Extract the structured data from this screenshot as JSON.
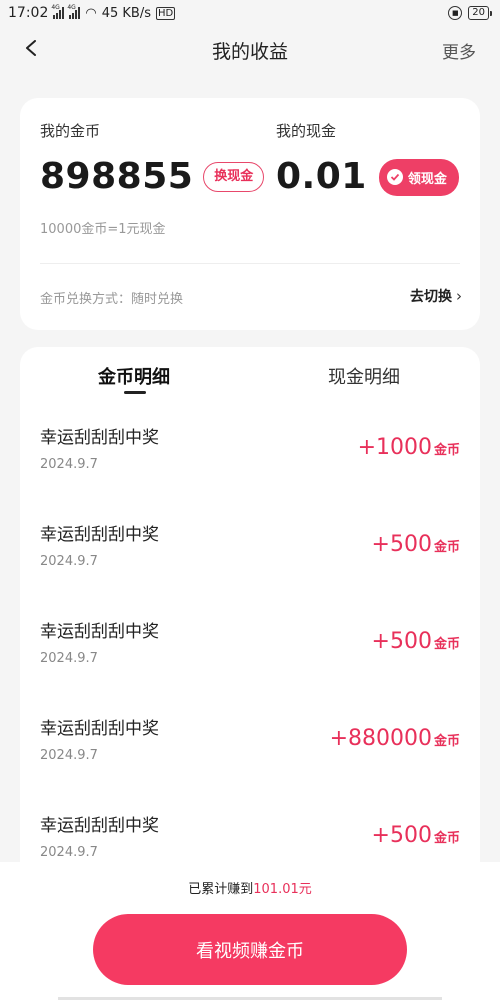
{
  "status_bar": {
    "time": "17:02",
    "signal_tag_1": "4G",
    "signal_tag_2": "4G",
    "network_speed": "45 KB/s",
    "hd_badge": "HD",
    "battery": "20"
  },
  "header": {
    "title": "我的收益",
    "more": "更多"
  },
  "summary": {
    "coins_label": "我的金币",
    "coins_value": "898855",
    "exchange_button": "换现金",
    "cash_label": "我的现金",
    "cash_value": "0.01",
    "withdraw_button": "领现金",
    "rate_note": "10000金币=1元现金",
    "exchange_method": "金币兑换方式：随时兑换",
    "switch_link": "去切换"
  },
  "tabs": {
    "coins": "金币明细",
    "cash": "现金明细",
    "active": "coins"
  },
  "records": [
    {
      "title": "幸运刮刮刮中奖",
      "date": "2024.9.7",
      "amount": "+1000",
      "unit": "金币"
    },
    {
      "title": "幸运刮刮刮中奖",
      "date": "2024.9.7",
      "amount": "+500",
      "unit": "金币"
    },
    {
      "title": "幸运刮刮刮中奖",
      "date": "2024.9.7",
      "amount": "+500",
      "unit": "金币"
    },
    {
      "title": "幸运刮刮刮中奖",
      "date": "2024.9.7",
      "amount": "+880000",
      "unit": "金币"
    },
    {
      "title": "幸运刮刮刮中奖",
      "date": "2024.9.7",
      "amount": "+500",
      "unit": "金币"
    }
  ],
  "footer": {
    "earned_prefix": "已累计赚到",
    "earned_amount": "101.01元",
    "cta_button": "看视频赚金币"
  },
  "colors": {
    "accent": "#f53a62",
    "accent_text": "#e8305a",
    "background": "#f5f5f5"
  }
}
